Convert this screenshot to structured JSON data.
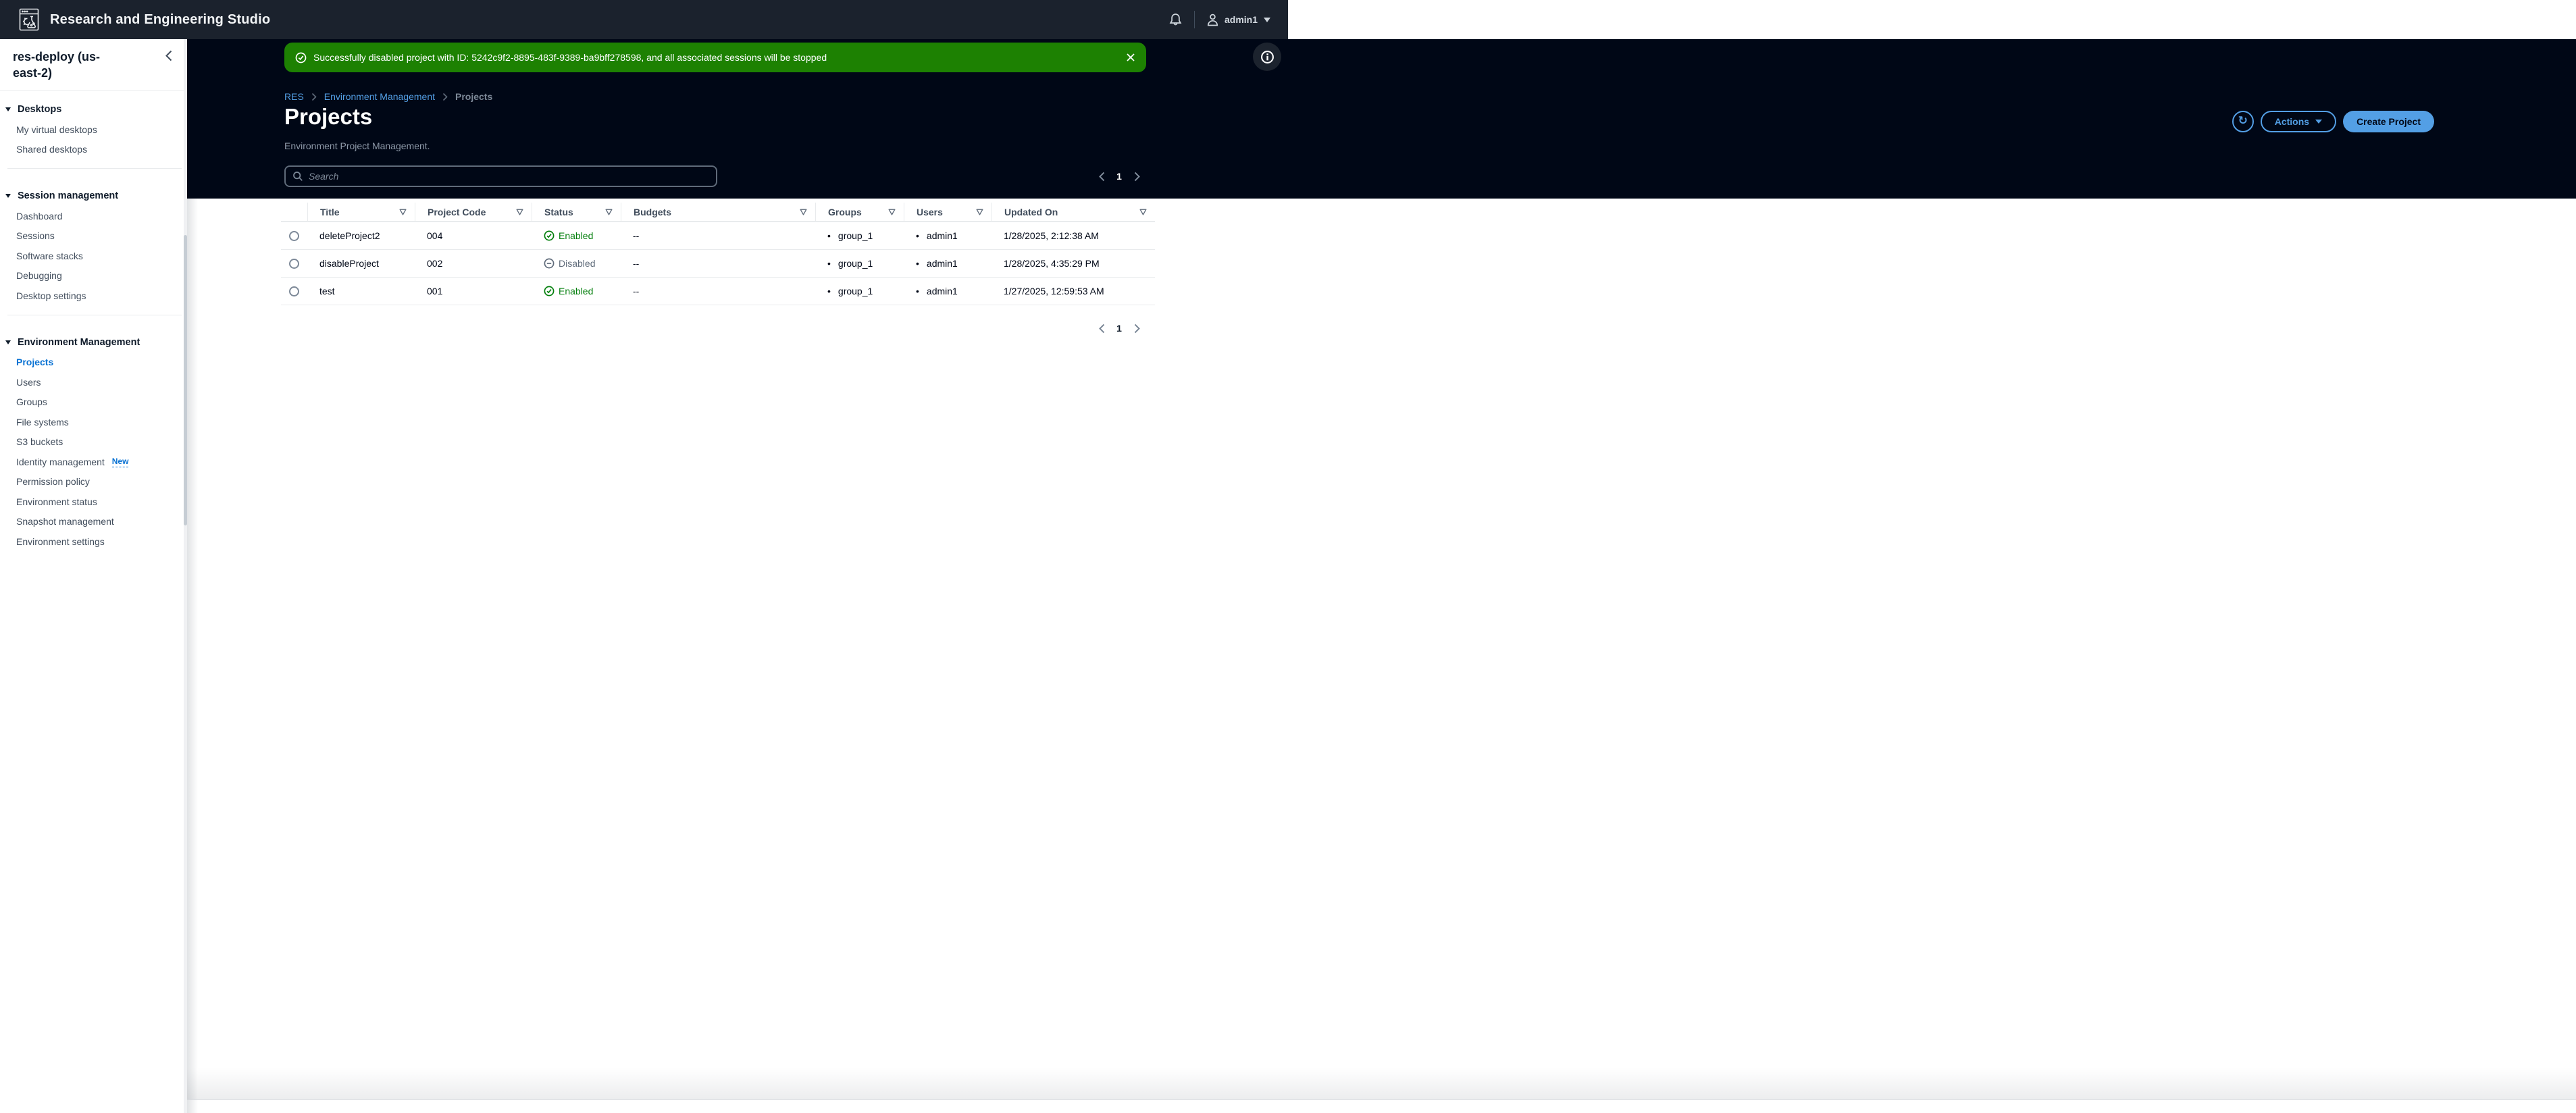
{
  "topbar": {
    "title": "Research and Engineering Studio",
    "user": "admin1"
  },
  "sidebar": {
    "region": "res-deploy (us-east-2)",
    "sections": [
      {
        "label": "Desktops",
        "items": [
          {
            "label": "My virtual desktops"
          },
          {
            "label": "Shared desktops"
          }
        ]
      },
      {
        "label": "Session management",
        "items": [
          {
            "label": "Dashboard"
          },
          {
            "label": "Sessions"
          },
          {
            "label": "Software stacks"
          },
          {
            "label": "Debugging"
          },
          {
            "label": "Desktop settings"
          }
        ]
      },
      {
        "label": "Environment Management",
        "items": [
          {
            "label": "Projects",
            "active": true
          },
          {
            "label": "Users"
          },
          {
            "label": "Groups"
          },
          {
            "label": "File systems"
          },
          {
            "label": "S3 buckets"
          },
          {
            "label": "Identity management",
            "badge": "New"
          },
          {
            "label": "Permission policy"
          },
          {
            "label": "Environment status"
          },
          {
            "label": "Snapshot management"
          },
          {
            "label": "Environment settings"
          }
        ]
      }
    ]
  },
  "flash": {
    "type": "success",
    "message": "Successfully disabled project with ID: 5242c9f2-8895-483f-9389-ba9bff278598, and all associated sessions will be stopped"
  },
  "breadcrumb": [
    "RES",
    "Environment Management",
    "Projects"
  ],
  "page": {
    "title": "Projects",
    "description": "Environment Project Management."
  },
  "actions": {
    "actions_label": "Actions",
    "create_label": "Create Project"
  },
  "search": {
    "placeholder": "Search"
  },
  "pagination": {
    "page": "1"
  },
  "table": {
    "columns": [
      "Title",
      "Project Code",
      "Status",
      "Budgets",
      "Groups",
      "Users",
      "Updated On"
    ],
    "rows": [
      {
        "title": "deleteProject2",
        "code": "004",
        "status": {
          "label": "Enabled",
          "state": "enabled"
        },
        "budgets": "--",
        "groups": [
          "group_1"
        ],
        "users": [
          "admin1"
        ],
        "updated": "1/28/2025, 2:12:38 AM"
      },
      {
        "title": "disableProject",
        "code": "002",
        "status": {
          "label": "Disabled",
          "state": "disabled"
        },
        "budgets": "--",
        "groups": [
          "group_1"
        ],
        "users": [
          "admin1"
        ],
        "updated": "1/28/2025, 4:35:29 PM"
      },
      {
        "title": "test",
        "code": "001",
        "status": {
          "label": "Enabled",
          "state": "enabled"
        },
        "budgets": "--",
        "groups": [
          "group_1"
        ],
        "users": [
          "admin1"
        ],
        "updated": "1/27/2025, 12:59:53 AM"
      }
    ]
  },
  "colors": {
    "accent": "#539fe5",
    "success_flash": "#1d8102",
    "nav_link_active": "#0972d3",
    "status_enabled": "#037f0c",
    "status_disabled": "#5f6b7a",
    "header_band": "#000716"
  }
}
